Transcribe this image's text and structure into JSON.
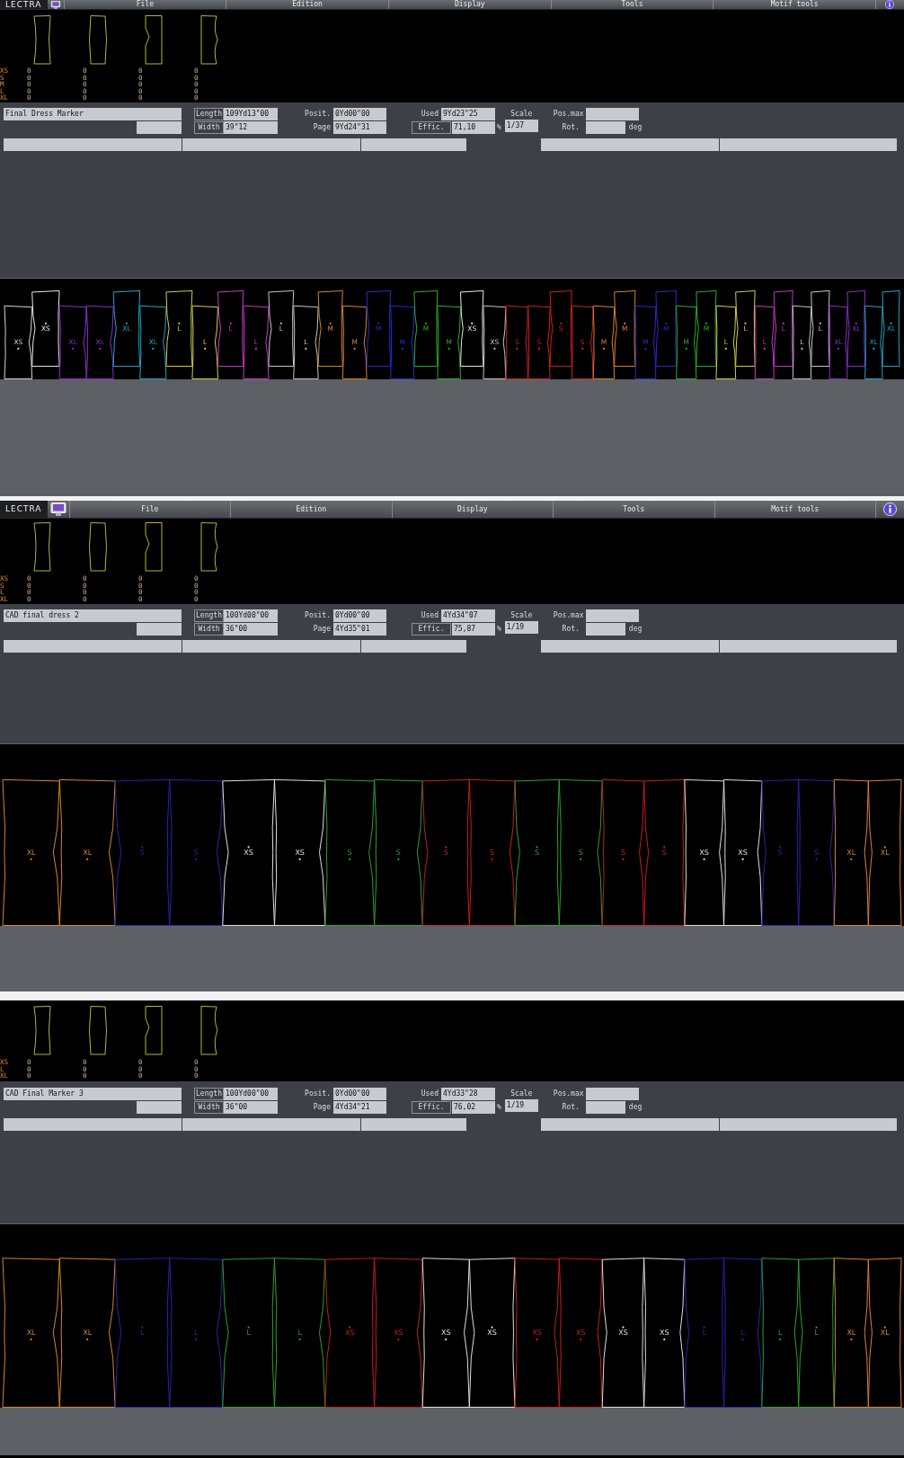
{
  "panels": [
    {
      "menu": {
        "logo": "LECTRA",
        "items": [
          "File",
          "Edition",
          "Display",
          "Tools",
          "Motif tools"
        ]
      },
      "models": {
        "sizes": [
          {
            "label": "XS",
            "quantities": [
              "0",
              "0",
              "0",
              "0"
            ]
          },
          {
            "label": "S",
            "quantities": [
              "0",
              "0",
              "0",
              "0"
            ]
          },
          {
            "label": "M",
            "quantities": [
              "0",
              "0",
              "0",
              "0"
            ]
          },
          {
            "label": "L",
            "quantities": [
              "0",
              "0",
              "0",
              "0"
            ]
          },
          {
            "label": "XL",
            "quantities": [
              "0",
              "0",
              "0",
              "0"
            ]
          }
        ]
      },
      "info": {
        "name": "Final Dress Marker",
        "length_label": "Length",
        "length": "109Yd13\"00",
        "width_label": "Width",
        "width": "39\"12",
        "posit_label": "Posit.",
        "posit": "0Yd00\"00",
        "page_label": "Page",
        "page": "9Yd24\"31",
        "used_label": "Used",
        "used": "9Yd23\"25",
        "effic_label": "Effic.",
        "effic": "71,10",
        "percent": "%",
        "scale_label": "Scale",
        "scale": "1/37",
        "posmax_label": "Pos.max",
        "rot_label": "Rot.",
        "rot_unit": "deg"
      },
      "marker": {
        "pieces": [
          {
            "label": "XS",
            "color": "#d8d8d8",
            "flipped": false
          },
          {
            "label": "XS",
            "color": "#ececec",
            "flipped": true
          },
          {
            "label": "XL",
            "color": "#8e2fd0",
            "flipped": false
          },
          {
            "label": "XL",
            "color": "#8e2fd0",
            "flipped": false
          },
          {
            "label": "XL",
            "color": "#22a8c8",
            "flipped": true
          },
          {
            "label": "XL",
            "color": "#22a8c8",
            "flipped": false
          },
          {
            "label": "L",
            "color": "#d8d040",
            "flipped": true
          },
          {
            "label": "L",
            "color": "#d8d040",
            "flipped": false
          },
          {
            "label": "L",
            "color": "#c83ac8",
            "flipped": true
          },
          {
            "label": "L",
            "color": "#c83ac8",
            "flipped": false
          },
          {
            "label": "L",
            "color": "#c8c8c8",
            "flipped": true
          },
          {
            "label": "L",
            "color": "#c8c8c8",
            "flipped": false
          },
          {
            "label": "M",
            "color": "#d8862c",
            "flipped": true
          },
          {
            "label": "M",
            "color": "#d8862c",
            "flipped": false
          },
          {
            "label": "M",
            "color": "#2a2ad0",
            "flipped": true
          },
          {
            "label": "M",
            "color": "#2a2ad0",
            "flipped": false
          },
          {
            "label": "M",
            "color": "#2cb02c",
            "flipped": true
          },
          {
            "label": "M",
            "color": "#2cb02c",
            "flipped": false
          },
          {
            "label": "XS",
            "color": "#ececec",
            "flipped": true
          },
          {
            "label": "XS",
            "color": "#c8c8c8",
            "flipped": false
          },
          {
            "label": "S",
            "color": "#d02020",
            "flipped": false
          },
          {
            "label": "S",
            "color": "#d02020",
            "flipped": false
          },
          {
            "label": "S",
            "color": "#d02020",
            "flipped": true
          },
          {
            "label": "S",
            "color": "#d02020",
            "flipped": false
          },
          {
            "label": "M",
            "color": "#d8862c",
            "flipped": false
          },
          {
            "label": "M",
            "color": "#d8862c",
            "flipped": true
          },
          {
            "label": "M",
            "color": "#2a2ad0",
            "flipped": false
          },
          {
            "label": "M",
            "color": "#2a2ad0",
            "flipped": true
          },
          {
            "label": "M",
            "color": "#2cb02c",
            "flipped": false
          },
          {
            "label": "M",
            "color": "#2cb02c",
            "flipped": true
          },
          {
            "label": "L",
            "color": "#d8d040",
            "flipped": false
          },
          {
            "label": "L",
            "color": "#d8d040",
            "flipped": true
          },
          {
            "label": "L",
            "color": "#c83ac8",
            "flipped": false
          },
          {
            "label": "L",
            "color": "#c83ac8",
            "flipped": true
          },
          {
            "label": "L",
            "color": "#c8c8c8",
            "flipped": false
          },
          {
            "label": "L",
            "color": "#c8c8c8",
            "flipped": true
          },
          {
            "label": "XL",
            "color": "#8e2fd0",
            "flipped": false
          },
          {
            "label": "XL",
            "color": "#8e2fd0",
            "flipped": true
          },
          {
            "label": "XL",
            "color": "#22a8c8",
            "flipped": false
          },
          {
            "label": "XL",
            "color": "#22a8c8",
            "flipped": true
          }
        ]
      }
    },
    {
      "menu": {
        "logo": "LECTRA",
        "items": [
          "File",
          "Edition",
          "Display",
          "Tools",
          "Motif tools"
        ]
      },
      "models": {
        "sizes": [
          {
            "label": "XS",
            "quantities": [
              "0",
              "0",
              "0",
              "0"
            ]
          },
          {
            "label": "S",
            "quantities": [
              "0",
              "0",
              "0",
              "0"
            ]
          },
          {
            "label": "L",
            "quantities": [
              "0",
              "0",
              "0",
              "0"
            ]
          },
          {
            "label": "XL",
            "quantities": [
              "0",
              "0",
              "0",
              "0"
            ]
          }
        ]
      },
      "info": {
        "name": "CAD final dress 2",
        "length_label": "Length",
        "length": "100Yd00\"00",
        "width_label": "Width",
        "width": "36\"00",
        "posit_label": "Posit.",
        "posit": "0Yd00\"00",
        "page_label": "Page",
        "page": "4Yd35\"01",
        "used_label": "Used",
        "used": "4Yd34\"07",
        "effic_label": "Effic.",
        "effic": "75,87",
        "percent": "%",
        "scale_label": "Scale",
        "scale": "1/19",
        "posmax_label": "Pos.max",
        "rot_label": "Rot.",
        "rot_unit": "deg"
      },
      "marker": {
        "pieces": [
          {
            "label": "XL",
            "color": "#d8862c",
            "flipped": false
          },
          {
            "label": "XL",
            "color": "#d8862c",
            "flipped": false
          },
          {
            "label": "S",
            "color": "#2626a8",
            "flipped": true
          },
          {
            "label": "S",
            "color": "#2626a8",
            "flipped": false
          },
          {
            "label": "XS",
            "color": "#e0e0e0",
            "flipped": true
          },
          {
            "label": "XS",
            "color": "#e0e0e0",
            "flipped": false
          },
          {
            "label": "S",
            "color": "#2ca02c",
            "flipped": false
          },
          {
            "label": "S",
            "color": "#2ca02c",
            "flipped": false
          },
          {
            "label": "S",
            "color": "#c81e1e",
            "flipped": true
          },
          {
            "label": "S",
            "color": "#c81e1e",
            "flipped": false
          },
          {
            "label": "S",
            "color": "#2ca02c",
            "flipped": true
          },
          {
            "label": "S",
            "color": "#2ca02c",
            "flipped": false
          },
          {
            "label": "S",
            "color": "#c81e1e",
            "flipped": false
          },
          {
            "label": "S",
            "color": "#c81e1e",
            "flipped": true
          },
          {
            "label": "XS",
            "color": "#e0e0e0",
            "flipped": false
          },
          {
            "label": "XS",
            "color": "#e0e0e0",
            "flipped": false
          },
          {
            "label": "S",
            "color": "#2626a8",
            "flipped": true
          },
          {
            "label": "S",
            "color": "#2626a8",
            "flipped": false
          },
          {
            "label": "XL",
            "color": "#d8862c",
            "flipped": false
          },
          {
            "label": "XL",
            "color": "#d8862c",
            "flipped": true
          }
        ]
      }
    },
    {
      "models": {
        "sizes": [
          {
            "label": "XS",
            "quantities": [
              "0",
              "0",
              "0",
              "0"
            ]
          },
          {
            "label": "L",
            "quantities": [
              "0",
              "0",
              "0",
              "0"
            ]
          },
          {
            "label": "XL",
            "quantities": [
              "0",
              "0",
              "0",
              "0"
            ]
          }
        ]
      },
      "info": {
        "name": "CAD Final Marker 3",
        "length_label": "Length",
        "length": "100Yd00\"00",
        "width_label": "Width",
        "width": "36\"00",
        "posit_label": "Posit.",
        "posit": "0Yd00\"00",
        "page_label": "Page",
        "page": "4Yd34\"21",
        "used_label": "Used",
        "used": "4Yd33\"28",
        "effic_label": "Effic.",
        "effic": "76,02",
        "percent": "%",
        "scale_label": "Scale",
        "scale": "1/19",
        "posmax_label": "Pos.max",
        "rot_label": "Rot.",
        "rot_unit": "deg"
      },
      "marker": {
        "pieces": [
          {
            "label": "XL",
            "color": "#d8862c",
            "flipped": false
          },
          {
            "label": "XL",
            "color": "#d8862c",
            "flipped": false
          },
          {
            "label": "L",
            "color": "#2626a8",
            "flipped": true
          },
          {
            "label": "L",
            "color": "#2626a8",
            "flipped": false
          },
          {
            "label": "L",
            "color": "#2ca02c",
            "flipped": true
          },
          {
            "label": "L",
            "color": "#2ca02c",
            "flipped": false
          },
          {
            "label": "XS",
            "color": "#c81e1e",
            "flipped": true
          },
          {
            "label": "XS",
            "color": "#c81e1e",
            "flipped": false
          },
          {
            "label": "XS",
            "color": "#e0e0e0",
            "flipped": false
          },
          {
            "label": "XS",
            "color": "#e0e0e0",
            "flipped": true
          },
          {
            "label": "XS",
            "color": "#c81e1e",
            "flipped": false
          },
          {
            "label": "XS",
            "color": "#c81e1e",
            "flipped": false
          },
          {
            "label": "XS",
            "color": "#e0e0e0",
            "flipped": true
          },
          {
            "label": "XS",
            "color": "#e0e0e0",
            "flipped": false
          },
          {
            "label": "L",
            "color": "#2626a8",
            "flipped": true
          },
          {
            "label": "L",
            "color": "#2626a8",
            "flipped": false
          },
          {
            "label": "L",
            "color": "#2ca02c",
            "flipped": false
          },
          {
            "label": "L",
            "color": "#2ca02c",
            "flipped": true
          },
          {
            "label": "XL",
            "color": "#d8862c",
            "flipped": false
          },
          {
            "label": "XL",
            "color": "#d8862c",
            "flipped": true
          }
        ]
      }
    }
  ]
}
